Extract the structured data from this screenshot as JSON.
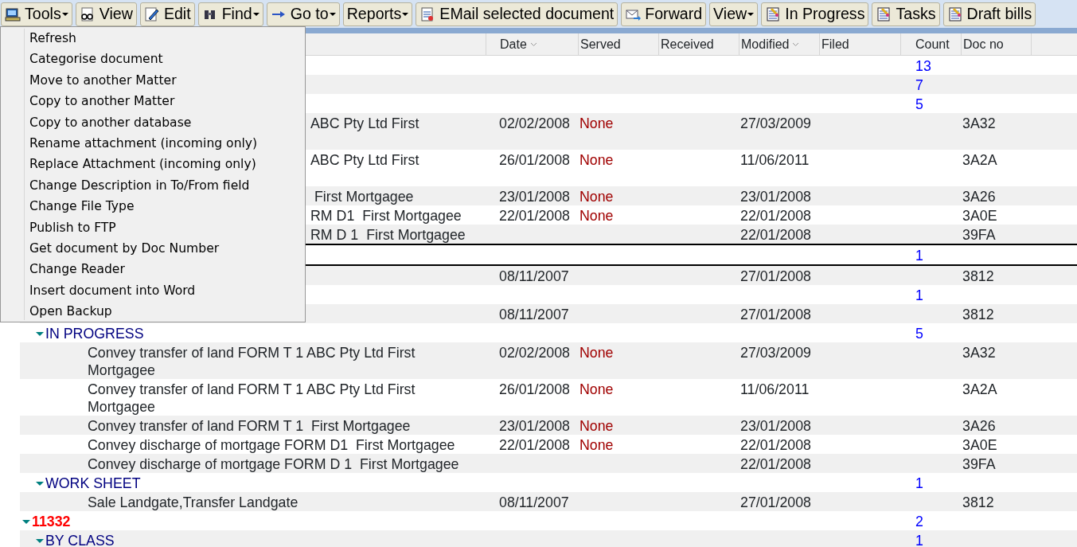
{
  "toolbar": [
    {
      "label": "Tools",
      "dropdown": true
    },
    {
      "label": "View",
      "dropdown": false
    },
    {
      "label": "Edit",
      "dropdown": false
    },
    {
      "label": "Find",
      "dropdown": true
    },
    {
      "label": "Go to",
      "dropdown": true
    },
    {
      "label": "Reports",
      "dropdown": true
    },
    {
      "label": "EMail selected document",
      "dropdown": false
    },
    {
      "label": "Forward",
      "dropdown": false
    },
    {
      "label": "View",
      "dropdown": true
    },
    {
      "label": "In Progress",
      "dropdown": false
    },
    {
      "label": "Tasks",
      "dropdown": false
    },
    {
      "label": "Draft bills",
      "dropdown": false
    }
  ],
  "menu": [
    "Refresh",
    "Categorise document",
    "Move to another Matter",
    "Copy to another Matter",
    "Copy to another database",
    "Rename attachment (incoming only)",
    "Replace Attachment (incoming only)",
    "Change Description in To/From field",
    "Change File Type",
    "Publish to FTP",
    "Get document by Doc Number",
    "Change Reader",
    "Insert document into Word",
    "Open Backup"
  ],
  "columns": [
    {
      "label": "Date",
      "sort_indicator": true
    },
    {
      "label": "Served",
      "sort_indicator": false
    },
    {
      "label": "Received",
      "sort_indicator": false
    },
    {
      "label": "Modified",
      "sort_indicator": true
    },
    {
      "label": "Filed",
      "sort_indicator": false
    },
    {
      "label": "Count",
      "sort_indicator": false
    },
    {
      "label": "Doc no",
      "sort_indicator": false
    }
  ],
  "tree": [
    {
      "kind": "group",
      "count": "13",
      "selected": false,
      "children": [
        {
          "kind": "group",
          "count": "7",
          "selected": false,
          "children": [
            {
              "kind": "group",
              "count": "5",
              "selected": false,
              "children": [
                {
                  "kind": "partial",
                  "text": "ABC Pty Ltd First",
                  "date": "02/02/2008",
                  "served": "None",
                  "modified": "27/03/2009",
                  "doc_no": "3A32",
                  "wrapped": true,
                  "selected": false
                },
                {
                  "kind": "partial",
                  "text": "ABC Pty Ltd First",
                  "date": "26/01/2008",
                  "served": "None",
                  "modified": "11/06/2011",
                  "doc_no": "3A2A",
                  "wrapped": true,
                  "selected": false
                },
                {
                  "kind": "partial",
                  "text": " First Mortgagee",
                  "date": "23/01/2008",
                  "served": "None",
                  "modified": "23/01/2008",
                  "doc_no": "3A26",
                  "wrapped": false,
                  "selected": false
                },
                {
                  "kind": "partial",
                  "text": "RM D1  First Mortgagee",
                  "date": "22/01/2008",
                  "served": "None",
                  "modified": "22/01/2008",
                  "doc_no": "3A0E",
                  "wrapped": false,
                  "selected": false
                },
                {
                  "kind": "partial",
                  "text": "RM D 1  First Mortgagee",
                  "modified": "22/01/2008",
                  "doc_no": "39FA",
                  "wrapped": false,
                  "selected": false
                }
              ]
            },
            {
              "kind": "group",
              "count": "1",
              "selected": true,
              "children": [
                {
                  "kind": "doc",
                  "date": "08/11/2007",
                  "modified": "27/01/2008",
                  "doc_no": "3812",
                  "selected": false
                }
              ]
            },
            {
              "kind": "group",
              "count": "1",
              "selected": false,
              "children": [
                {
                  "kind": "doc",
                  "date": "08/11/2007",
                  "modified": "27/01/2008",
                  "doc_no": "3812",
                  "selected": false
                }
              ]
            }
          ]
        },
        {
          "kind": "group",
          "label": "IN PROGRESS",
          "count": "5",
          "expanded": true,
          "selected": false,
          "children": [
            {
              "kind": "doc",
              "text": "Convey transfer of land FORM T 1 ABC Pty Ltd First Mortgagee",
              "date": "02/02/2008",
              "served": "None",
              "modified": "27/03/2009",
              "doc_no": "3A32",
              "selected": false
            },
            {
              "kind": "doc",
              "text": "Convey transfer of land FORM T 1 ABC Pty Ltd First Mortgagee",
              "date": "26/01/2008",
              "served": "None",
              "modified": "11/06/2011",
              "doc_no": "3A2A",
              "selected": false
            },
            {
              "kind": "doc",
              "text": "Convey transfer of land FORM T 1  First Mortgagee",
              "date": "23/01/2008",
              "served": "None",
              "modified": "23/01/2008",
              "doc_no": "3A26",
              "selected": false
            },
            {
              "kind": "doc",
              "text": "Convey discharge of mortgage FORM D1  First Mortgagee",
              "date": "22/01/2008",
              "served": "None",
              "modified": "22/01/2008",
              "doc_no": "3A0E",
              "selected": false
            },
            {
              "kind": "doc",
              "text": "Convey discharge of mortgage FORM D 1  First Mortgagee",
              "modified": "22/01/2008",
              "doc_no": "39FA",
              "selected": false
            }
          ]
        },
        {
          "kind": "group",
          "label": "WORK SHEET",
          "count": "1",
          "expanded": true,
          "selected": false,
          "children": [
            {
              "kind": "doc",
              "text": "Sale Landgate,Transfer Landgate",
              "date": "08/11/2007",
              "modified": "27/01/2008",
              "doc_no": "3812",
              "selected": false
            }
          ]
        }
      ]
    },
    {
      "kind": "matter",
      "label": "11332",
      "count": "2",
      "expanded": true,
      "selected": false,
      "children": [
        {
          "kind": "group",
          "label": "BY CLASS",
          "count": "1",
          "expanded": true,
          "selected": false
        }
      ]
    }
  ]
}
